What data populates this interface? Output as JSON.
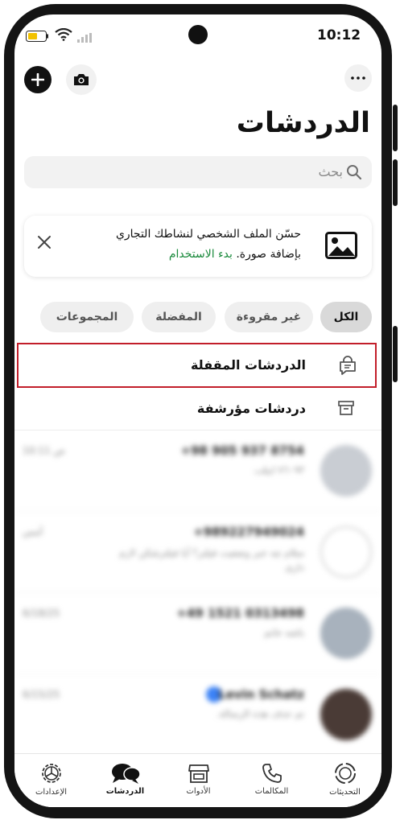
{
  "status_bar": {
    "time": "10:12"
  },
  "header": {
    "title": "الدردشات"
  },
  "search": {
    "placeholder": "بحث"
  },
  "banner": {
    "line1": "حسّن الملف الشخصي لنشاطك التجاري",
    "line2_prefix": "بإضافة صورة.",
    "line2_link": "بدء الاستخدام"
  },
  "filters": [
    "الكل",
    "غير مقروءة",
    "المفضلة",
    "المجموعات"
  ],
  "rows": {
    "locked": "الدردشات المقفلة",
    "archived": "دردشات مؤرشفة"
  },
  "chats": [
    {
      "name": "+98 905 937 8754",
      "time": "10:11 ص",
      "preview": "٧٦٠٩٣ ابيلب"
    },
    {
      "name": "+989227949024",
      "time": "أمس",
      "preview": "سلام چه خبر وضعیت فیلتر؟ آیا فیلترشکن لازم داری"
    },
    {
      "name": "+49 1521 0313498",
      "time": "6/18/25",
      "preview": "باشه خانم"
    },
    {
      "name": "Levin Schatz",
      "time": "6/15/25",
      "preview": "تم حذف هذه الرسالة."
    }
  ],
  "tabs": [
    "التحديثات",
    "المكالمات",
    "الأدوات",
    "الدردشات",
    "الإعدادات"
  ],
  "colors": {
    "accent": "#1a8a3c",
    "highlight_border": "#c21e2a"
  }
}
